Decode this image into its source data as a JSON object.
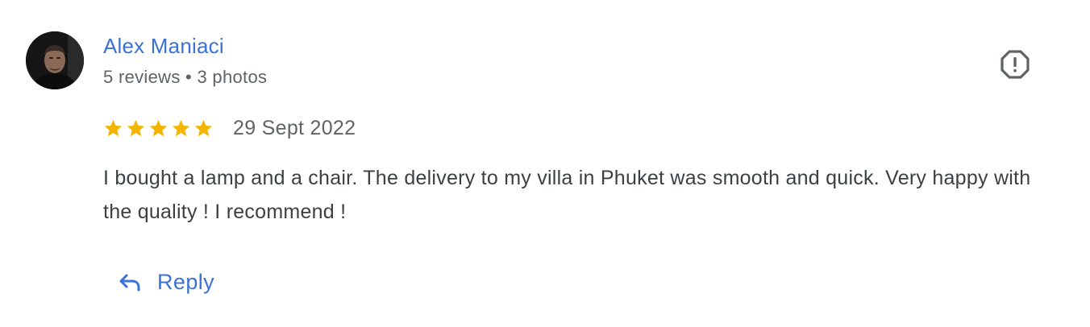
{
  "review": {
    "author": {
      "name": "Alex Maniaci",
      "reviews": "5 reviews",
      "separator": "•",
      "photos": "3 photos",
      "avatar_icon": "user-photo-avatar"
    },
    "rating": 5,
    "rating_max": 5,
    "date": "29 Sept 2022",
    "text": "I bought a lamp and a chair. The delivery to my villa in Phuket was smooth and quick. Very happy with the quality ! I recommend !",
    "actions": {
      "report_icon": "report-flag-icon",
      "reply_icon": "reply-arrow-icon",
      "reply_label": "Reply"
    }
  },
  "colors": {
    "accent": "#3b72d6",
    "star": "#f4b400",
    "text": "#3c4043",
    "muted": "#5f6368",
    "icon": "#5f6368"
  }
}
